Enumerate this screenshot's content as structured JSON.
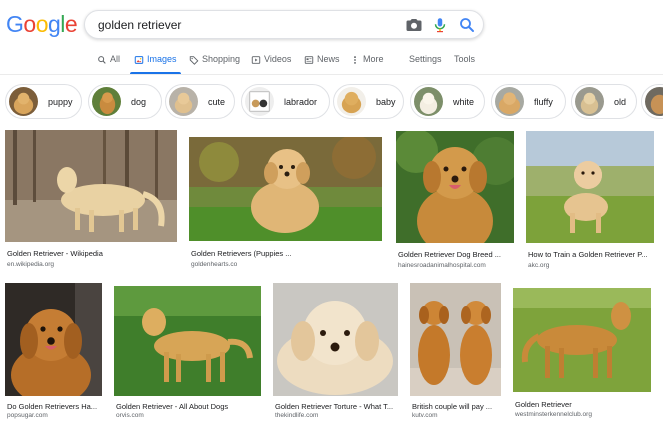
{
  "logo": [
    "G",
    "o",
    "o",
    "g",
    "l",
    "e"
  ],
  "logo_colors": [
    "#4285f4",
    "#ea4335",
    "#fbbc05",
    "#4285f4",
    "#34a853",
    "#ea4335"
  ],
  "search": {
    "query": "golden retriever"
  },
  "tabs": [
    {
      "label": "All",
      "icon": "search-icon"
    },
    {
      "label": "Images",
      "icon": "image-icon",
      "active": true
    },
    {
      "label": "Shopping",
      "icon": "tag-icon"
    },
    {
      "label": "Videos",
      "icon": "play-icon"
    },
    {
      "label": "News",
      "icon": "newspaper-icon"
    },
    {
      "label": "More",
      "icon": "more-icon"
    },
    {
      "label": "Settings"
    },
    {
      "label": "Tools"
    }
  ],
  "chips": [
    "puppy",
    "dog",
    "cute",
    "labrador",
    "baby",
    "white",
    "fluffy",
    "old"
  ],
  "results": [
    {
      "title": "Golden Retriever - Wikipedia",
      "source": "en.wikipedia.org"
    },
    {
      "title": "Golden Retrievers (Puppies ...",
      "source": "goldenhearts.co"
    },
    {
      "title": "Golden Retriever Dog Breed ...",
      "source": "hainesroadanimalhospital.com"
    },
    {
      "title": "How to Train a Golden Retriever P...",
      "source": "akc.org"
    },
    {
      "title": "Do Golden Retrievers Ha...",
      "source": "popsugar.com"
    },
    {
      "title": "Golden Retriever - All About Dogs",
      "source": "orvis.com"
    },
    {
      "title": "Golden Retriever Torture - What T...",
      "source": "thekindlife.com"
    },
    {
      "title": "British couple will pay ...",
      "source": "kutv.com"
    },
    {
      "title": "Golden Retriever",
      "source": "westminsterkennelclub.org"
    }
  ],
  "colors": {
    "accent": "#1a73e8",
    "muted": "#5f6368",
    "text": "#202124",
    "border": "#dfe1e5"
  }
}
